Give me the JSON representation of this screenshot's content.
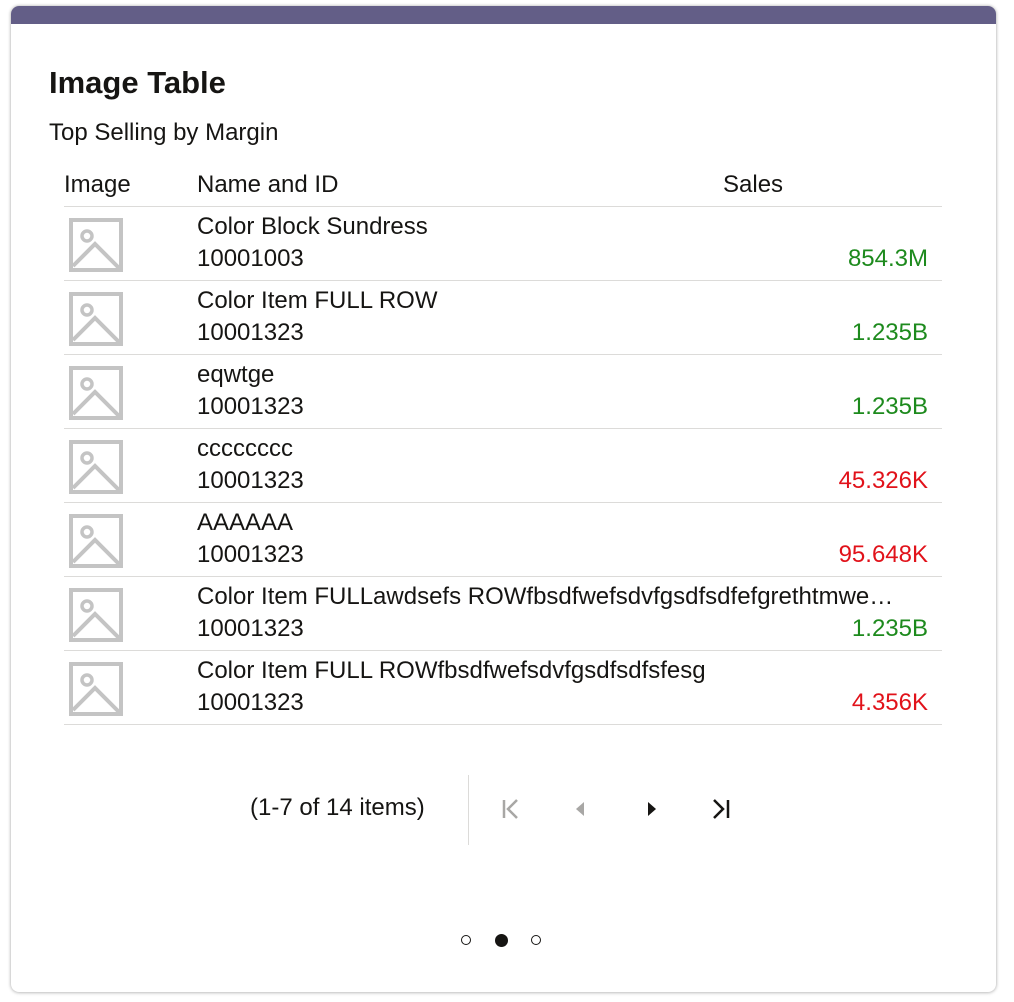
{
  "card": {
    "title": "Image Table",
    "subtitle": "Top Selling by Margin",
    "accent_color": "#635e87"
  },
  "table": {
    "headers": {
      "image": "Image",
      "name_id": "Name and ID",
      "sales": "Sales"
    },
    "rows": [
      {
        "name": "Color Block Sundress",
        "id": "10001003",
        "sales": "854.3M",
        "status": "positive"
      },
      {
        "name": "Color Item FULL ROW",
        "id": "10001323",
        "sales": "1.235B",
        "status": "positive"
      },
      {
        "name": "eqwtge",
        "id": "10001323",
        "sales": "1.235B",
        "status": "positive"
      },
      {
        "name": "cccccccc",
        "id": "10001323",
        "sales": "45.326K",
        "status": "negative"
      },
      {
        "name": "AAAAAA",
        "id": "10001323",
        "sales": "95.648K",
        "status": "negative"
      },
      {
        "name": "Color Item FULLawdsefs ROWfbsdfwefsdvfgsdfsdfefgrethtmwe…",
        "id": "10001323",
        "sales": "1.235B",
        "status": "positive"
      },
      {
        "name": "Color Item FULL ROWfbsdfwefsdvfgsdfsdfsfesg",
        "id": "10001323",
        "sales": "4.356K",
        "status": "negative"
      }
    ],
    "thumbnail_icon": "image-placeholder-icon"
  },
  "colors": {
    "positive": "#1d8a1d",
    "negative": "#e1121a",
    "placeholder_icon": "#c4c4c4"
  },
  "pagination": {
    "info": "(1-7 of 14 items)",
    "first_icon": "first-page-icon",
    "prev_icon": "previous-page-icon",
    "next_icon": "next-page-icon",
    "last_icon": "last-page-icon"
  },
  "carousel": {
    "pages": 3,
    "active_index": 1
  }
}
